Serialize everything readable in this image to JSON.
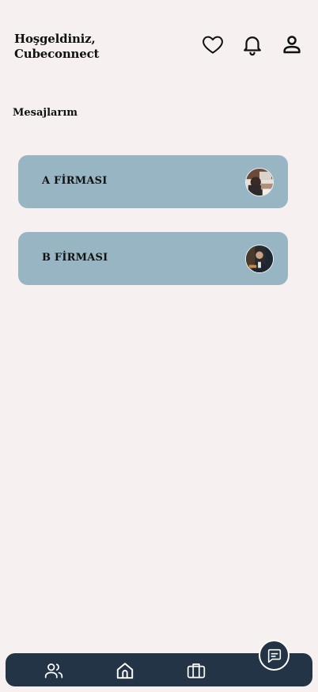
{
  "header": {
    "greeting_line1": "Hoşgeldiniz,",
    "greeting_line2": "Cubeconnect",
    "icons": [
      "heart-icon",
      "bell-icon",
      "user-icon"
    ]
  },
  "messages": {
    "title": "Mesajlarım",
    "threads": [
      {
        "name": "A FİRMASI",
        "avatar": "company-a-avatar"
      },
      {
        "name": "B FİRMASI",
        "avatar": "company-b-avatar"
      }
    ]
  },
  "bottom_nav": {
    "items": [
      "users-icon",
      "home-icon",
      "briefcase-icon"
    ],
    "fab": "chat-icon"
  },
  "colors": {
    "background": "#f6f0f0",
    "card": "#97b5c2",
    "nav": "#243447"
  }
}
